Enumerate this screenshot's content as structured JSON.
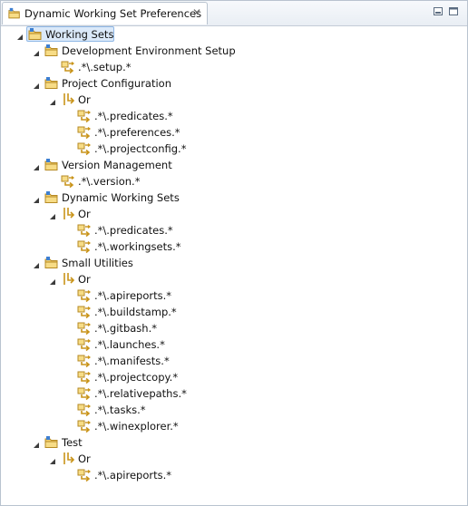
{
  "view": {
    "tab_title": "Dynamic Working Set Preferences",
    "tab_icon": "working-set-folder-icon",
    "close_icon": "close-icon",
    "minimize_icon": "minimize-icon",
    "maximize_icon": "maximize-icon"
  },
  "tree": [
    {
      "label": "Working Sets",
      "depth": 0,
      "kind": "root",
      "expanded": true,
      "selected": true
    },
    {
      "label": "Development Environment Setup",
      "depth": 1,
      "kind": "set",
      "expanded": true
    },
    {
      "label": ".*\\.setup.*",
      "depth": 2,
      "kind": "pattern"
    },
    {
      "label": "Project Configuration",
      "depth": 1,
      "kind": "set",
      "expanded": true
    },
    {
      "label": "Or",
      "depth": 2,
      "kind": "or",
      "expanded": true
    },
    {
      "label": ".*\\.predicates.*",
      "depth": 3,
      "kind": "pattern"
    },
    {
      "label": ".*\\.preferences.*",
      "depth": 3,
      "kind": "pattern"
    },
    {
      "label": ".*\\.projectconfig.*",
      "depth": 3,
      "kind": "pattern"
    },
    {
      "label": "Version Management",
      "depth": 1,
      "kind": "set",
      "expanded": true
    },
    {
      "label": ".*\\.version.*",
      "depth": 2,
      "kind": "pattern"
    },
    {
      "label": "Dynamic Working Sets",
      "depth": 1,
      "kind": "set",
      "expanded": true
    },
    {
      "label": "Or",
      "depth": 2,
      "kind": "or",
      "expanded": true
    },
    {
      "label": ".*\\.predicates.*",
      "depth": 3,
      "kind": "pattern"
    },
    {
      "label": ".*\\.workingsets.*",
      "depth": 3,
      "kind": "pattern"
    },
    {
      "label": "Small Utilities",
      "depth": 1,
      "kind": "set",
      "expanded": true
    },
    {
      "label": "Or",
      "depth": 2,
      "kind": "or",
      "expanded": true
    },
    {
      "label": ".*\\.apireports.*",
      "depth": 3,
      "kind": "pattern"
    },
    {
      "label": ".*\\.buildstamp.*",
      "depth": 3,
      "kind": "pattern"
    },
    {
      "label": ".*\\.gitbash.*",
      "depth": 3,
      "kind": "pattern"
    },
    {
      "label": ".*\\.launches.*",
      "depth": 3,
      "kind": "pattern"
    },
    {
      "label": ".*\\.manifests.*",
      "depth": 3,
      "kind": "pattern"
    },
    {
      "label": ".*\\.projectcopy.*",
      "depth": 3,
      "kind": "pattern"
    },
    {
      "label": ".*\\.relativepaths.*",
      "depth": 3,
      "kind": "pattern"
    },
    {
      "label": ".*\\.tasks.*",
      "depth": 3,
      "kind": "pattern"
    },
    {
      "label": ".*\\.winexplorer.*",
      "depth": 3,
      "kind": "pattern"
    },
    {
      "label": "Test",
      "depth": 1,
      "kind": "set",
      "expanded": true
    },
    {
      "label": "Or",
      "depth": 2,
      "kind": "or",
      "expanded": true
    },
    {
      "label": ".*\\.apireports.*",
      "depth": 3,
      "kind": "pattern"
    }
  ],
  "icons": {
    "root": "working-set-folder-icon",
    "set": "working-set-folder-icon",
    "or": "or-operator-icon",
    "pattern": "name-pattern-icon",
    "twisty": "expanded-twisty-icon"
  },
  "colors": {
    "selection_bg": "#dbe9f9",
    "selection_border": "#8eb7e6",
    "folder": "#e9b949",
    "badge": "#3d7fd1",
    "pattern_arrow": "#c9941a"
  }
}
